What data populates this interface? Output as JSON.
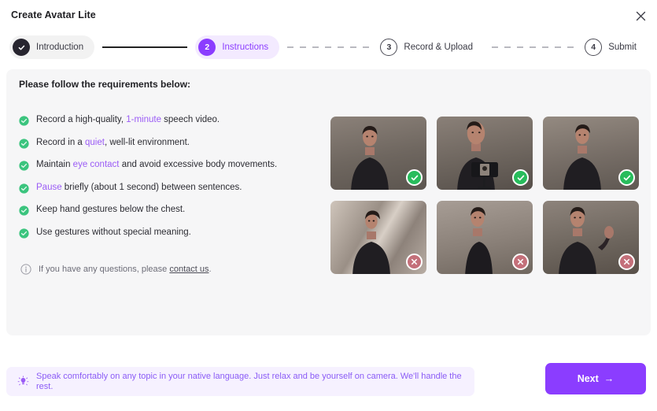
{
  "header": {
    "title": "Create Avatar Lite",
    "close_icon": "close-icon"
  },
  "stepper": {
    "steps": [
      {
        "marker": "✓",
        "label": "Introduction",
        "state": "done"
      },
      {
        "marker": "2",
        "label": "Instructions",
        "state": "active"
      },
      {
        "marker": "3",
        "label": "Record & Upload",
        "state": "idle"
      },
      {
        "marker": "4",
        "label": "Submit",
        "state": "idle"
      }
    ],
    "connectors": [
      "solid",
      "dashed",
      "dashed"
    ]
  },
  "card": {
    "title": "Please follow the requirements below:",
    "requirements": [
      {
        "icon": "check-circle-icon",
        "parts": [
          {
            "t": "Record a high-quality, ",
            "hl": false
          },
          {
            "t": "1-minute",
            "hl": true
          },
          {
            "t": " speech video.",
            "hl": false
          }
        ]
      },
      {
        "icon": "check-circle-icon",
        "parts": [
          {
            "t": "Record in a ",
            "hl": false
          },
          {
            "t": "quiet",
            "hl": true
          },
          {
            "t": ", well-lit environment.",
            "hl": false
          }
        ]
      },
      {
        "icon": "check-circle-icon",
        "parts": [
          {
            "t": "Maintain ",
            "hl": false
          },
          {
            "t": "eye contact",
            "hl": true
          },
          {
            "t": " and avoid excessive body movements.",
            "hl": false
          }
        ]
      },
      {
        "icon": "check-circle-icon",
        "parts": [
          {
            "t": "Pause",
            "hl": true
          },
          {
            "t": " briefly (about 1 second) between sentences.",
            "hl": false
          }
        ]
      },
      {
        "icon": "check-circle-icon",
        "parts": [
          {
            "t": "Keep hand gestures below the chest.",
            "hl": false
          }
        ]
      },
      {
        "icon": "check-circle-icon",
        "parts": [
          {
            "t": "Use gestures without special meaning.",
            "hl": false
          }
        ]
      }
    ],
    "note": {
      "icon": "info-icon",
      "text_before": "If you have any questions, please ",
      "link": "contact us",
      "text_after": "."
    },
    "examples": [
      {
        "id": "good-front-facing",
        "status": "ok",
        "badge_icon": "check-icon"
      },
      {
        "id": "good-phone-framing",
        "status": "ok",
        "badge_icon": "check-icon"
      },
      {
        "id": "good-hands-clasped",
        "status": "ok",
        "badge_icon": "check-icon"
      },
      {
        "id": "bad-harsh-shadows",
        "status": "no",
        "badge_icon": "x-icon"
      },
      {
        "id": "bad-side-profile",
        "status": "no",
        "badge_icon": "x-icon"
      },
      {
        "id": "bad-hand-above-chest",
        "status": "no",
        "badge_icon": "x-icon"
      }
    ]
  },
  "footer": {
    "tip": {
      "icon": "lightbulb-icon",
      "text": "Speak comfortably on any topic in your native language. Just relax and be yourself on camera. We'll handle the rest."
    },
    "next_label": "Next",
    "next_arrow": "→"
  },
  "colors": {
    "accent": "#8b3dff",
    "accent_soft": "#f3eaff",
    "highlight_text": "#9b5cf6",
    "success": "#28bc5c",
    "danger": "#c4707a",
    "card_bg": "#f6f6f7",
    "tip_bg": "#f6f1ff"
  }
}
